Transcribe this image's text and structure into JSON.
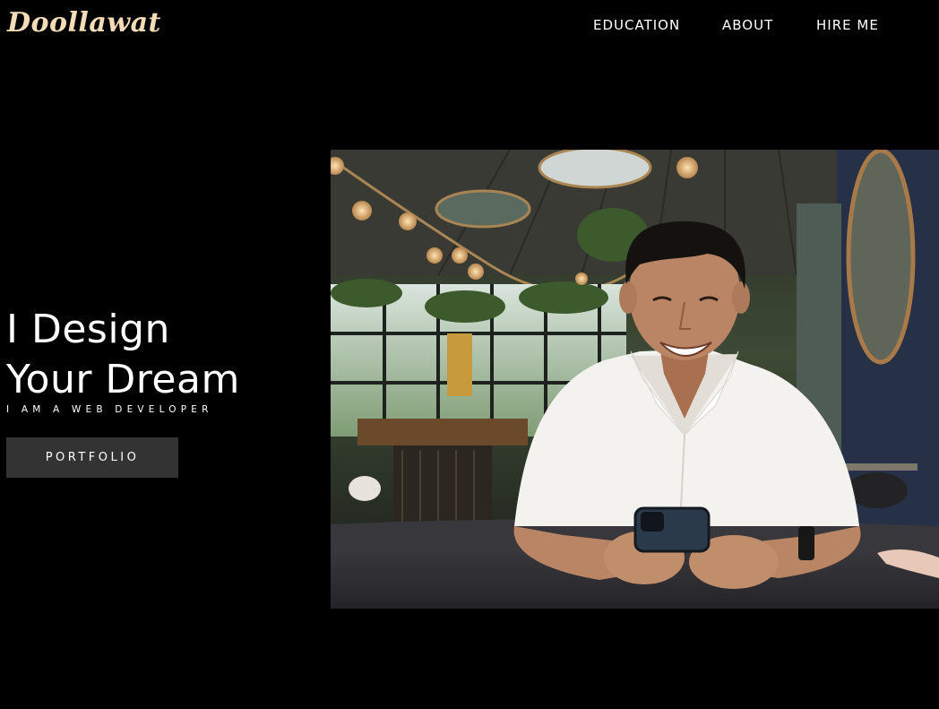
{
  "header": {
    "logo": "Doollawat",
    "nav": [
      {
        "label": "EDUCATION"
      },
      {
        "label": "ABOUT"
      },
      {
        "label": "HIRE ME"
      }
    ]
  },
  "hero": {
    "title_line1": "I Design",
    "title_line2": "Your Dream",
    "subtitle": "I AM A WEB DEVELOPER",
    "button_label": "PORTFOLIO"
  },
  "photo": {
    "alt": "man smiling holding phone in cafe",
    "colors": {
      "shirt": "#f4f2ee",
      "skin": "#b98565",
      "hair": "#15110f",
      "table": "#2e2d31",
      "wall": "#263047",
      "mirror_frame": "#a87a4a",
      "lamp": "#f0c68a"
    }
  },
  "colors": {
    "background": "#000000",
    "logo": "#f3dcb6",
    "text": "#ffffff",
    "button_bg": "#333333"
  }
}
